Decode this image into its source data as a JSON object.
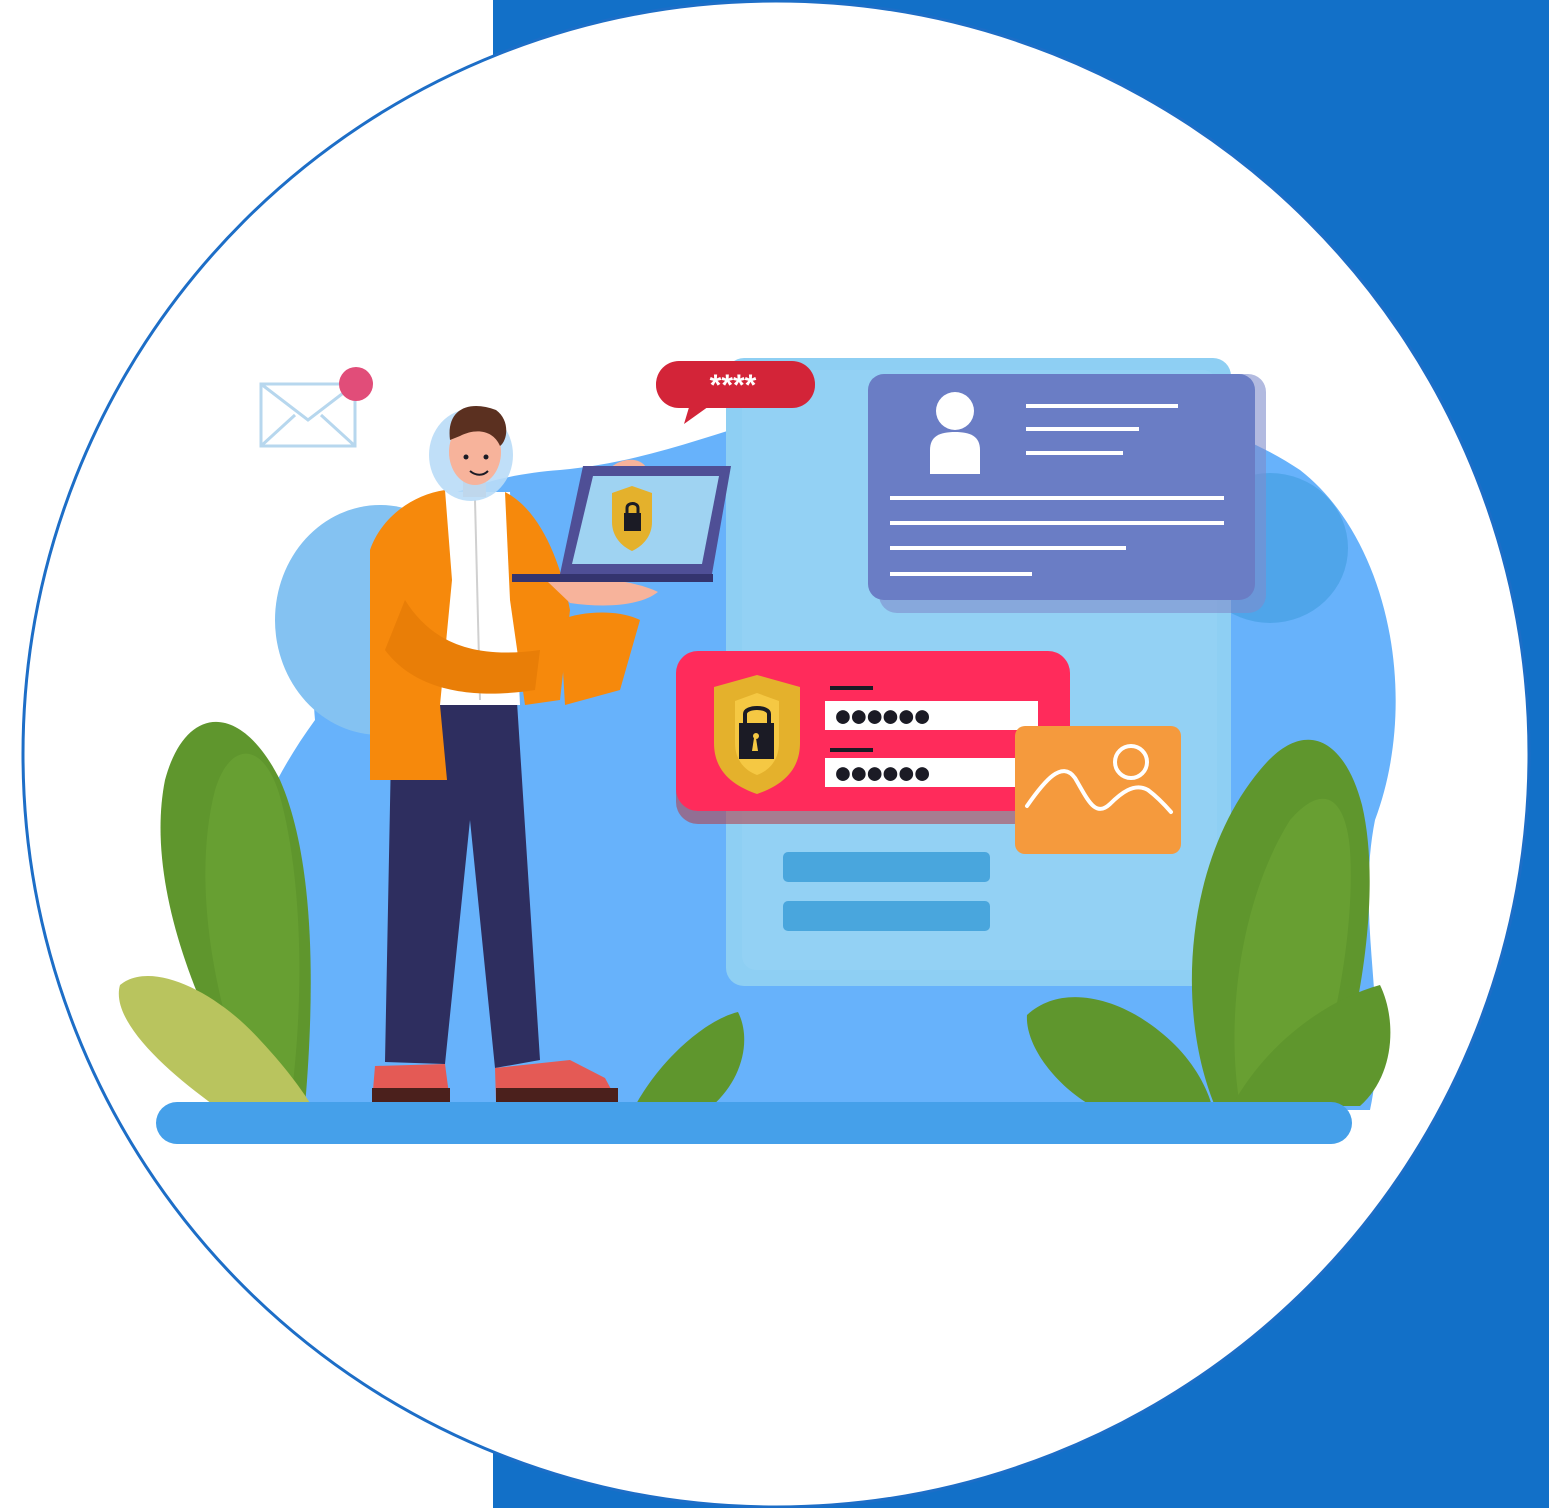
{
  "colors": {
    "page_background": "#ffffff",
    "panel_blue": "#1270c8",
    "circle_fill": "#ffffff",
    "scene_blue": "#67b2fb",
    "document_blue": "#8ecff3",
    "profile_card": "#6a7dc5",
    "password_card": "#ff2b5b",
    "shield_gold": "#e4b12c",
    "photo_card": "#f59a3d",
    "leaf_green": "#5f962d",
    "jacket_orange": "#f6890c",
    "pants_navy": "#2e2e5f"
  },
  "speech_bubble": {
    "text": "****"
  },
  "password_dots": {
    "field_1": "●●●●●●",
    "field_2": "●●●●●●"
  },
  "icons": {
    "envelope": "envelope-icon",
    "notification": "notification-dot-icon",
    "profile": "user-profile-icon",
    "lock_shield": "shield-lock-icon",
    "photo": "image-icon"
  }
}
